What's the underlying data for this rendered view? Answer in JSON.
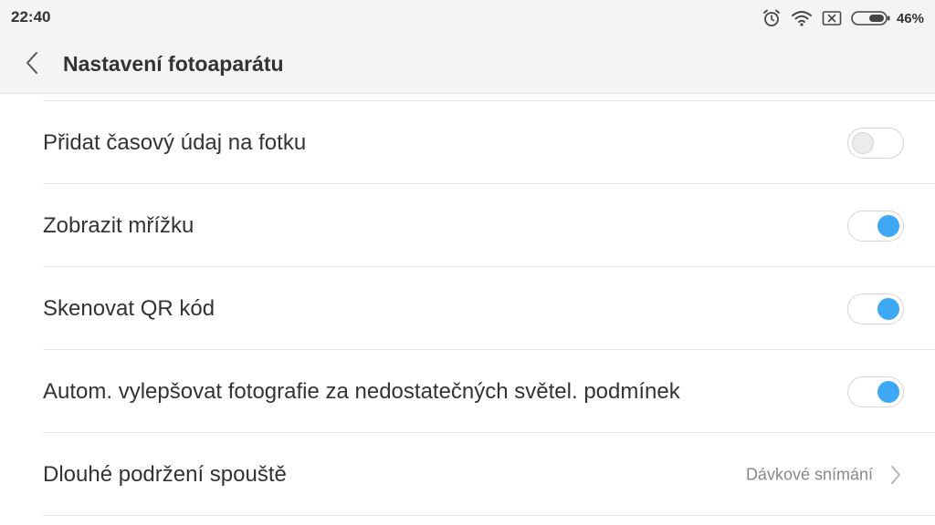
{
  "status_bar": {
    "time": "22:40",
    "icons": [
      "alarm-icon",
      "wifi-icon",
      "no-sim-icon",
      "battery-icon"
    ],
    "battery_percent": "46%"
  },
  "header": {
    "back_icon": "chevron-left-icon",
    "title": "Nastavení fotoaparátu"
  },
  "settings": [
    {
      "label": "Přidat časový údaj na fotku",
      "type": "toggle",
      "enabled": false
    },
    {
      "label": "Zobrazit mřížku",
      "type": "toggle",
      "enabled": true
    },
    {
      "label": "Skenovat QR kód",
      "type": "toggle",
      "enabled": true
    },
    {
      "label": "Autom. vylepšovat fotografie za nedostatečných světel. podmínek",
      "type": "toggle",
      "enabled": true
    },
    {
      "label": "Dlouhé podržení spouště",
      "type": "select",
      "value": "Dávkové snímání",
      "icon": "chevron-right-icon"
    }
  ],
  "colors": {
    "toggle_on": "#3ea8f5",
    "toggle_off": "#ececec",
    "header_bg": "#f4f4f4",
    "text_primary": "#333333",
    "text_secondary": "#888888"
  }
}
